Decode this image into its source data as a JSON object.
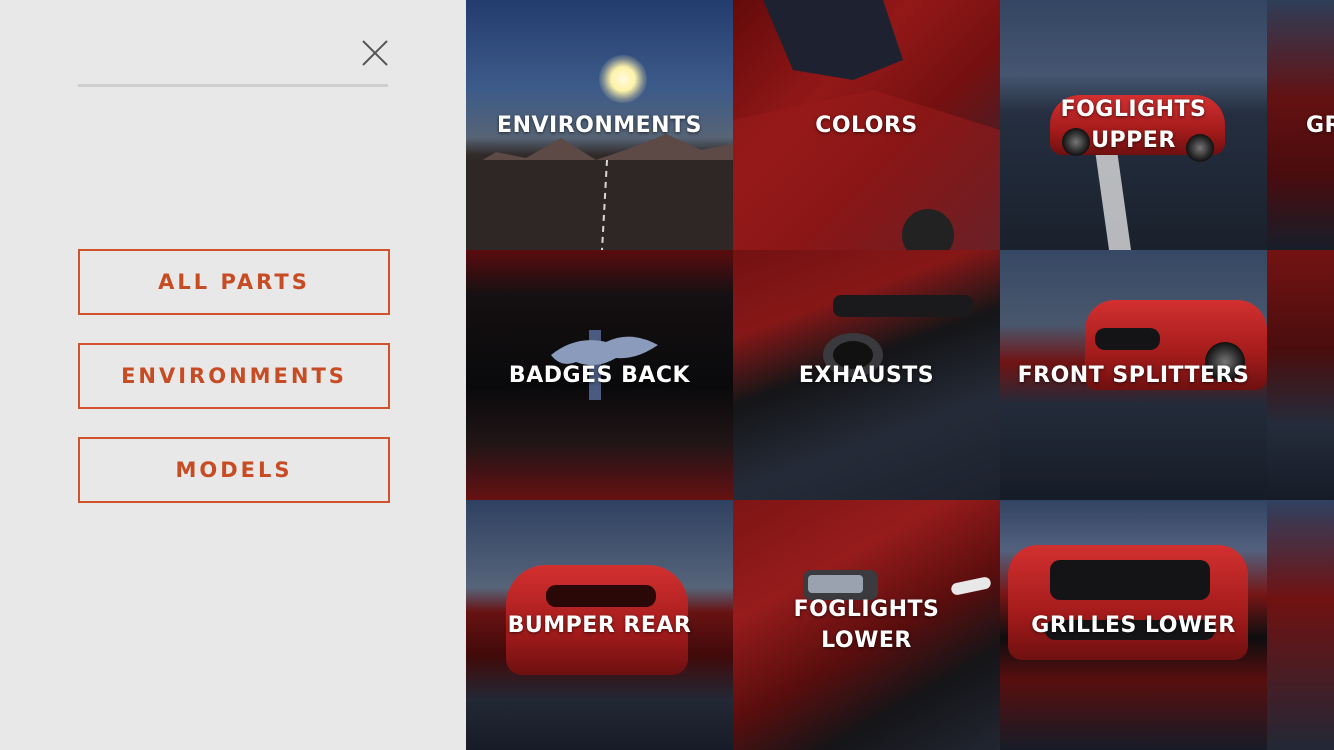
{
  "sidebar": {
    "search": {
      "value": ""
    },
    "close_icon": "close-icon",
    "menu": [
      {
        "label": "ALL PARTS"
      },
      {
        "label": "ENVIRONMENTS"
      },
      {
        "label": "MODELS"
      }
    ],
    "accent_color": "#c74c23"
  },
  "grid": {
    "tiles": [
      {
        "label": "ENVIRONMENTS"
      },
      {
        "label": "COLORS"
      },
      {
        "label": "FOGLIGHTS\nUPPER"
      },
      {
        "label": "GR"
      },
      {
        "label": "BADGES BACK"
      },
      {
        "label": "EXHAUSTS"
      },
      {
        "label": "FRONT SPLITTERS"
      },
      {
        "label": ""
      },
      {
        "label": "BUMPER REAR"
      },
      {
        "label": "FOGLIGHTS\nLOWER"
      },
      {
        "label": "GRILLES LOWER"
      },
      {
        "label": ""
      }
    ]
  }
}
